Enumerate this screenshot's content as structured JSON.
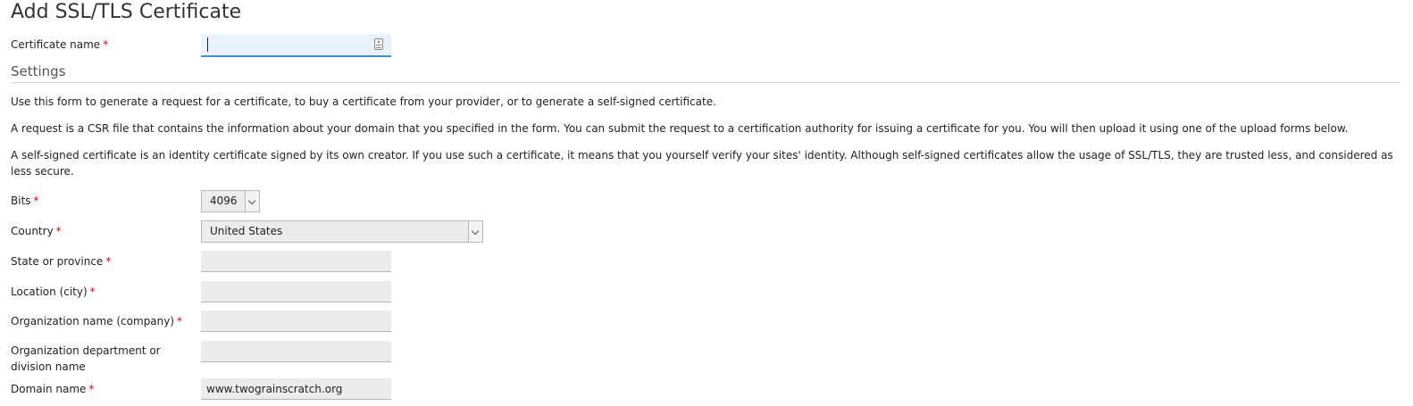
{
  "page": {
    "title": "Add SSL/TLS Certificate"
  },
  "certificate_name": {
    "label": "Certificate name",
    "required_mark": "*",
    "value": ""
  },
  "settings": {
    "title": "Settings",
    "paragraphs": [
      "Use this form to generate a request for a certificate, to buy a certificate from your provider, or to generate a self-signed certificate.",
      "A request is a CSR file that contains the information about your domain that you specified in the form. You can submit the request to a certification authority for issuing a certificate for you. You will then upload it using one of the upload forms below.",
      "A self-signed certificate is an identity certificate signed by its own creator. If you use such a certificate, it means that you yourself verify your sites' identity. Although self-signed certificates allow the usage of SSL/TLS, they are trusted less, and considered as less secure."
    ]
  },
  "form": {
    "bits": {
      "label": "Bits",
      "required_mark": "*",
      "value": "4096"
    },
    "country": {
      "label": "Country",
      "required_mark": "*",
      "value": "United States"
    },
    "state": {
      "label": "State or province",
      "required_mark": "*",
      "value": ""
    },
    "location": {
      "label": "Location (city)",
      "required_mark": "*",
      "value": ""
    },
    "organization": {
      "label": "Organization name (company)",
      "required_mark": "*",
      "value": ""
    },
    "department": {
      "label": "Organization department or division name",
      "value": ""
    },
    "domain": {
      "label": "Domain name",
      "required_mark": "*",
      "value": "www.twograinscratch.org"
    }
  },
  "icons": {
    "name_field_icon": "contact-card-icon",
    "select_arrow": "chevron-down-icon"
  },
  "colors": {
    "required": "#d0021b",
    "focus_border": "#3c8fd0",
    "focus_background": "#eaf3fb",
    "field_background": "#ececec"
  }
}
